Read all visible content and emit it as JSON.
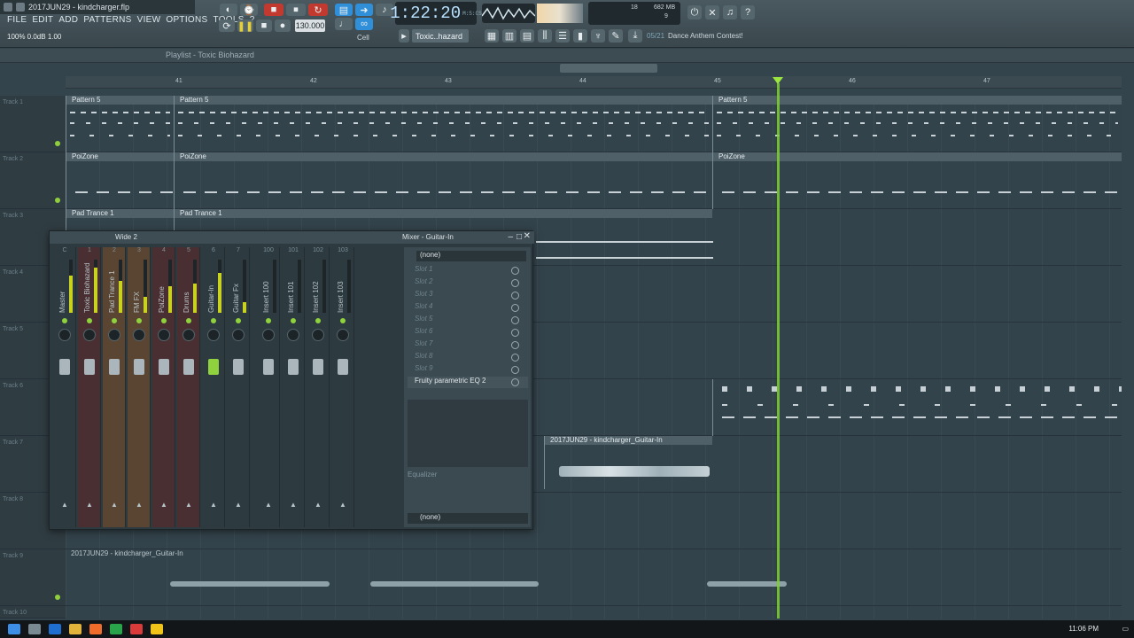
{
  "window": {
    "file_title": "2017JUN29 - kindcharger.flp"
  },
  "menu": [
    "FILE",
    "EDIT",
    "ADD",
    "PATTERNS",
    "VIEW",
    "OPTIONS",
    "TOOLS",
    "?"
  ],
  "hint": "100% 0.0dB 1.00",
  "transport": {
    "tempo": "130.000",
    "time": "1:22:20",
    "time_unit": "M:S:CS",
    "cpu_a": "18",
    "ram": "682 MB",
    "cpu_b": "9"
  },
  "pattern": {
    "selected": "Toxic..hazard",
    "cell_label": "Cell"
  },
  "hintbar": {
    "count": "05/21",
    "text": "Dance Anthem Contest!"
  },
  "playlist": {
    "title": "Playlist - Toxic Biohazard",
    "ruler": [
      "41",
      "42",
      "43",
      "44",
      "45",
      "46",
      "47"
    ]
  },
  "tracks": [
    "Track 1",
    "Track 2",
    "Track 3",
    "Track 4",
    "Track 5",
    "Track 6",
    "Track 7",
    "Track 8",
    "Track 9",
    "Track 10"
  ],
  "clips": {
    "pattern5": "Pattern 5",
    "poizone": "PoiZone",
    "padtrance": "Pad Trance 1",
    "guitar": "2017JUN29 - kindcharger_Guitar-In"
  },
  "mixer": {
    "left_title": "Wide 2",
    "right_title": "Mixer - Guitar-In",
    "strips": [
      {
        "num": "C",
        "name": "Master",
        "meter": 0.7,
        "color": "#2d3a40"
      },
      {
        "num": "1",
        "name": "Toxic Biohazard",
        "meter": 0.85,
        "color": "#4a2f32"
      },
      {
        "num": "2",
        "name": "Pad Trance 1",
        "meter": 0.6,
        "color": "#5a4533"
      },
      {
        "num": "3",
        "name": "FM FX",
        "meter": 0.3,
        "color": "#5a4533"
      },
      {
        "num": "4",
        "name": "PoiZone",
        "meter": 0.5,
        "color": "#4a2f32"
      },
      {
        "num": "5",
        "name": "Drums",
        "meter": 0.55,
        "color": "#4a2f32"
      },
      {
        "num": "6",
        "name": "Guitar-In",
        "meter": 0.75,
        "color": "#2d3a40"
      },
      {
        "num": "7",
        "name": "Guitar Fx",
        "meter": 0.2,
        "color": "#2d3a40"
      },
      {
        "num": "100",
        "name": "Insert 100",
        "meter": 0,
        "color": "#2d3a40"
      },
      {
        "num": "101",
        "name": "Insert 101",
        "meter": 0,
        "color": "#2d3a40"
      },
      {
        "num": "102",
        "name": "Insert 102",
        "meter": 0,
        "color": "#2d3a40"
      },
      {
        "num": "103",
        "name": "Insert 103",
        "meter": 0,
        "color": "#2d3a40"
      }
    ],
    "slot_top": "(none)",
    "slots": [
      "Slot 1",
      "Slot 2",
      "Slot 3",
      "Slot 4",
      "Slot 5",
      "Slot 6",
      "Slot 7",
      "Slot 8",
      "Slot 9"
    ],
    "active_slot": "Fruity parametric EQ 2",
    "eq_label": "Equalizer",
    "slot_bottom": "(none)"
  },
  "taskbar": {
    "time": "11:06 PM"
  }
}
